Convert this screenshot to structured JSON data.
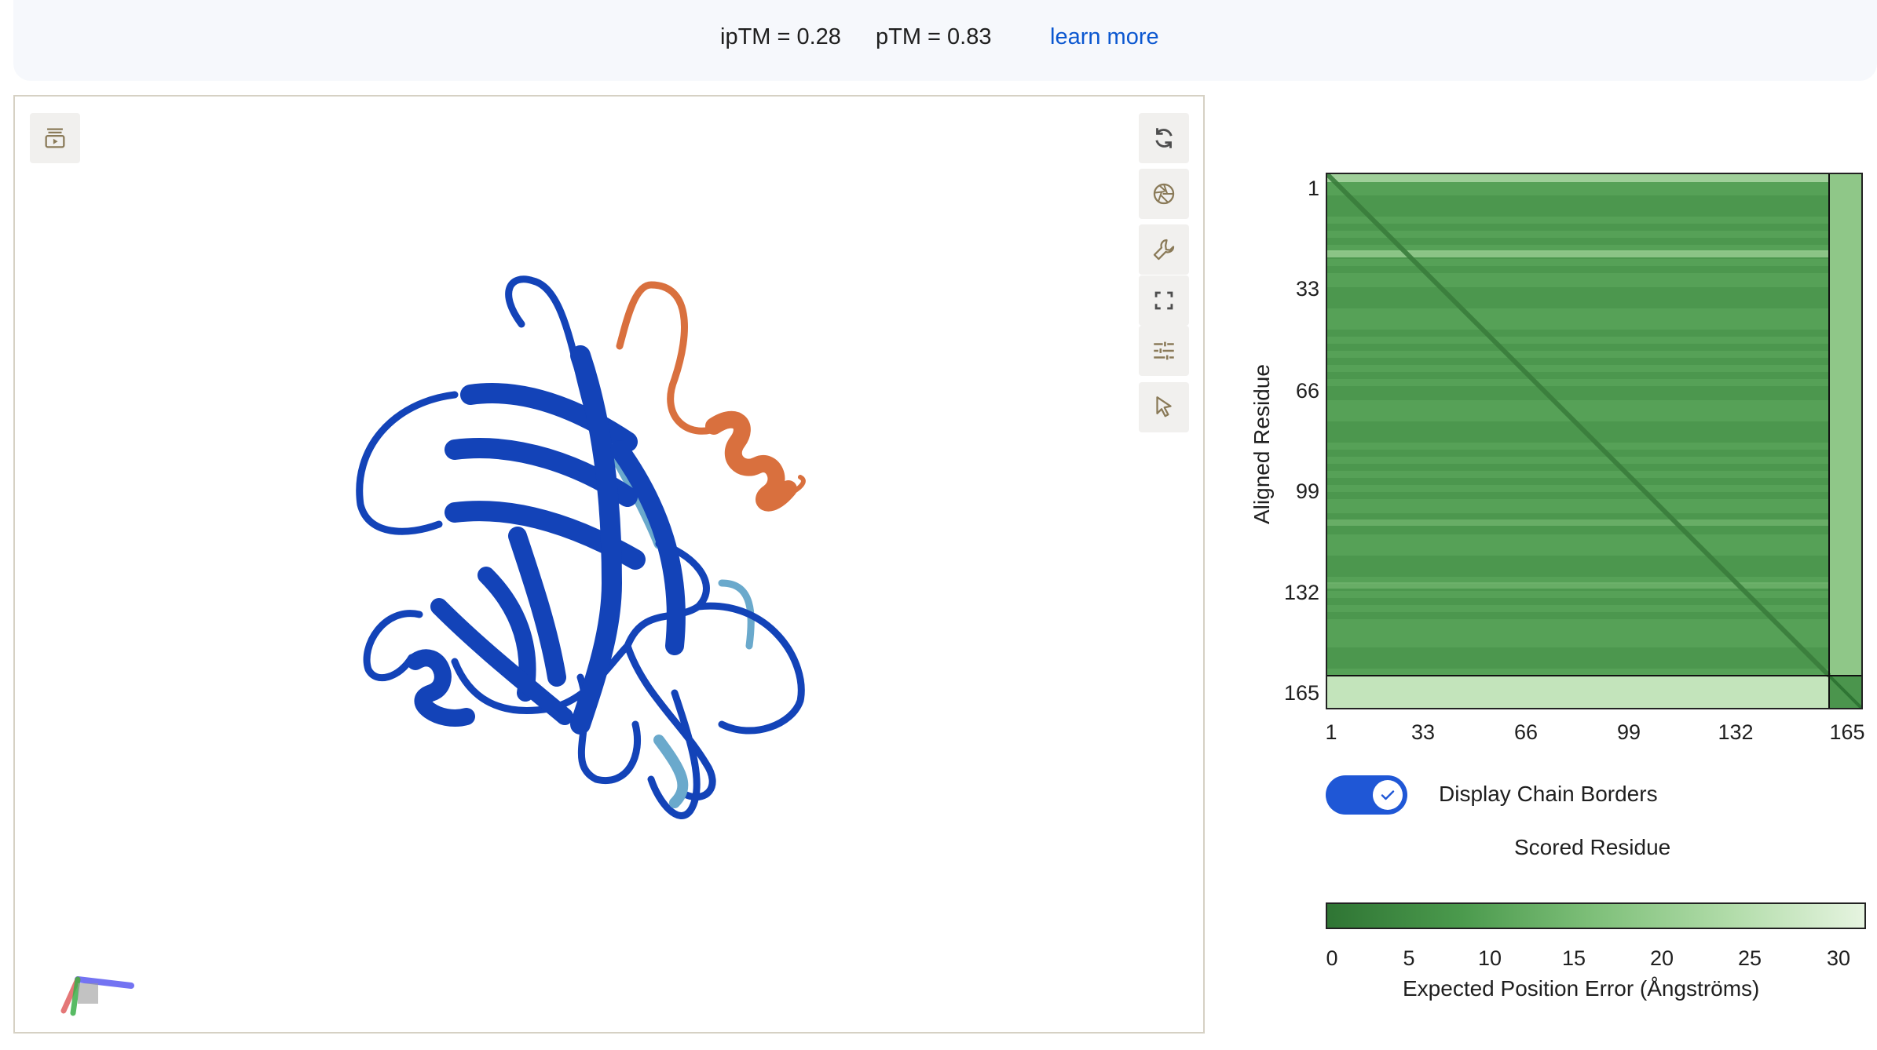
{
  "header": {
    "iptm": "ipTM = 0.28",
    "ptm": "pTM = 0.83",
    "learn_more": "learn more"
  },
  "viewer": {
    "tools": [
      {
        "icon": "playlist-play-icon"
      },
      {
        "icon": "refresh-icon"
      },
      {
        "icon": "aperture-icon"
      },
      {
        "icon": "wrench-icon"
      },
      {
        "icon": "fullscreen-icon"
      },
      {
        "icon": "tune-icon"
      },
      {
        "icon": "pointer-icon"
      }
    ],
    "colors": {
      "chain_a": "#1343b8",
      "chain_a_low": "#6aa9cc",
      "chain_b": "#d9703e"
    }
  },
  "pae": {
    "y_axis_title": "Aligned Residue",
    "x_axis_title": "Scored Residue",
    "ticks": [
      "1",
      "33",
      "66",
      "99",
      "132",
      "165"
    ],
    "chain_break_residue": 155,
    "total_residues": 165,
    "toggle": {
      "label": "Display Chain Borders",
      "checked": true
    },
    "colorbar": {
      "ticks": [
        "0",
        "5",
        "10",
        "15",
        "20",
        "25",
        "30"
      ],
      "label": "Expected Position Error (Ångströms)",
      "min_color": "#2f7534",
      "max_color": "#e6f4e0"
    }
  }
}
